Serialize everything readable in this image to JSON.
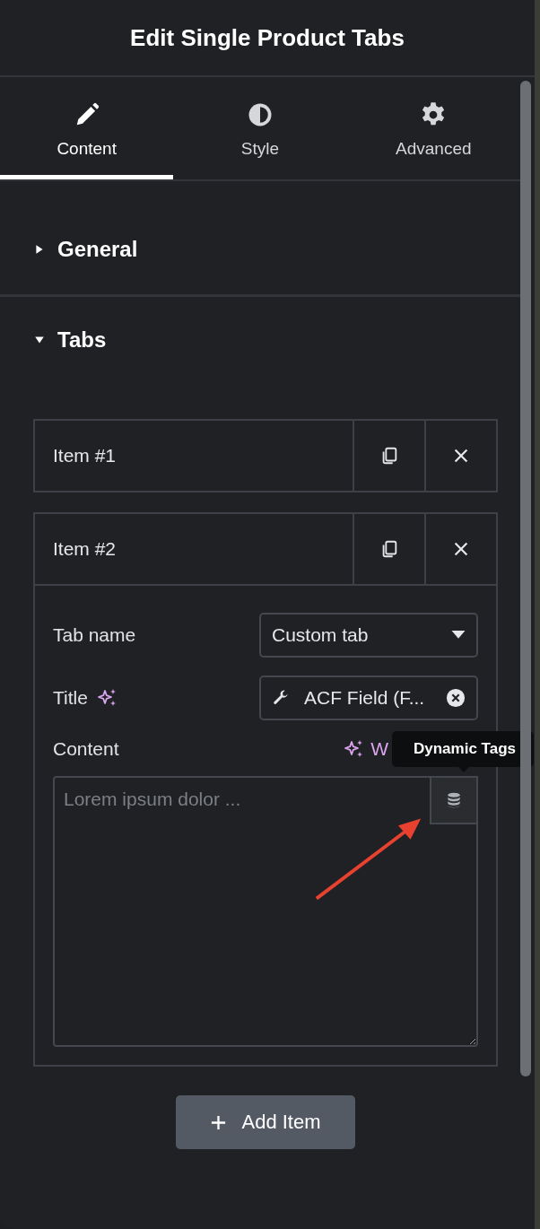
{
  "header": {
    "title": "Edit Single Product Tabs"
  },
  "tabs": [
    {
      "label": "Content",
      "selected": true
    },
    {
      "label": "Style",
      "selected": false
    },
    {
      "label": "Advanced",
      "selected": false
    }
  ],
  "sections": [
    {
      "title": "General",
      "expanded": false
    },
    {
      "title": "Tabs",
      "expanded": true
    }
  ],
  "repeater": {
    "items": [
      {
        "label": "Item #1",
        "expanded": false
      },
      {
        "label": "Item #2",
        "expanded": true
      }
    ],
    "fields": [
      {
        "kind": "select",
        "label": "Tab name",
        "value": "Custom tab"
      },
      {
        "kind": "dynamic",
        "label": "Title",
        "value": "ACF Field (F..."
      },
      {
        "kind": "textarea",
        "label": "Content",
        "ai_link": "W",
        "placeholder": "Lorem ipsum dolor ..."
      }
    ],
    "add_button": "Add Item"
  },
  "tooltip": "Dynamic Tags"
}
